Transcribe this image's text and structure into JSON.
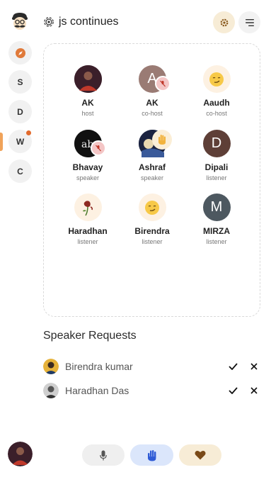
{
  "room": {
    "title": "js continues"
  },
  "rail": {
    "items": [
      "S",
      "D",
      "W",
      "C"
    ]
  },
  "participants": [
    {
      "name": "AK",
      "role": "host"
    },
    {
      "name": "AK",
      "role": "co-host",
      "initial": "A"
    },
    {
      "name": "Aaudh",
      "role": "co-host"
    },
    {
      "name": "Bhavay",
      "role": "speaker"
    },
    {
      "name": "Ashraf",
      "role": "speaker"
    },
    {
      "name": "Dipali",
      "role": "listener",
      "initial": "D"
    },
    {
      "name": "Haradhan",
      "role": "listener"
    },
    {
      "name": "Birendra",
      "role": "listener"
    },
    {
      "name": "MIRZA",
      "role": "listener",
      "initial": "M"
    }
  ],
  "speaker_requests": {
    "title": "Speaker Requests",
    "items": [
      {
        "name": "Birendra kumar"
      },
      {
        "name": "Haradhan Das"
      }
    ]
  },
  "colors": {
    "accent": "#f0a35a",
    "notification_dot": "#e26a2c",
    "mute_badge": "#f4c6c6",
    "hand_button": "#dbe6fb",
    "heart_button": "#f7ecd6"
  },
  "icons": {
    "logo": "mustache-face-icon",
    "compass": "compass-icon",
    "settings": "gear-icon",
    "menu": "menu-icon",
    "mic_muted": "mic-off-icon",
    "raised_hand": "raised-hand-icon",
    "mic": "mic-icon",
    "hand": "hand-icon",
    "heart": "heart-icon",
    "accept": "check-icon",
    "reject": "close-icon"
  }
}
